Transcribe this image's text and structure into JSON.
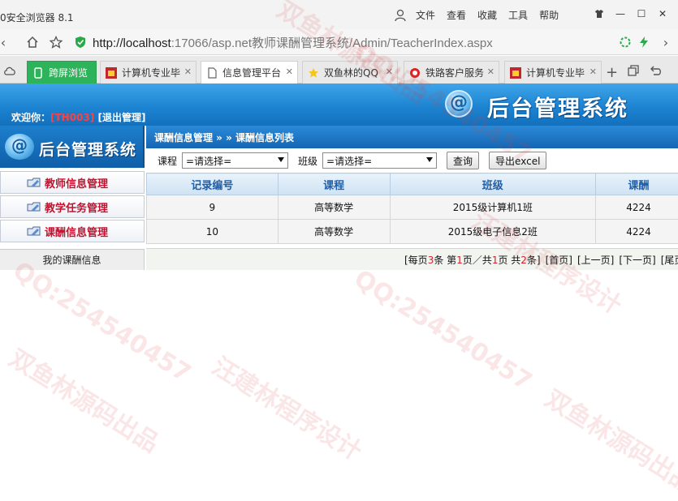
{
  "browser": {
    "app_title": "0安全浏览器 8.1",
    "menus": [
      "文件",
      "查看",
      "收藏",
      "工具",
      "帮助"
    ],
    "url_host": "http://localhost",
    "url_rest": ":17066/asp.net教师课酬管理系统/Admin/TeacherIndex.aspx",
    "tabs": [
      {
        "label": "跨屏浏览"
      },
      {
        "label": "计算机专业毕"
      },
      {
        "label": "信息管理平台"
      },
      {
        "label": "双鱼林的QQ"
      },
      {
        "label": "铁路客户服务"
      },
      {
        "label": "计算机专业毕"
      }
    ]
  },
  "header": {
    "welcome": "欢迎你：",
    "user_id": "[TH003]",
    "logout": "[退出管理]",
    "logo_glyph": "@",
    "system_name": "后台管理系统"
  },
  "sidebar": {
    "logo_glyph": "@",
    "logo_text": "后台管理系统",
    "items": [
      {
        "label": "教师信息管理"
      },
      {
        "label": "教学任务管理"
      },
      {
        "label": "课酬信息管理"
      }
    ],
    "footer": "我的课酬信息"
  },
  "breadcrumb": "课酬信息管理 » » 课酬信息列表",
  "filter": {
    "course_label": "课程",
    "course_value": "=请选择=",
    "class_label": "班级",
    "class_value": "=请选择=",
    "query_label": "查询",
    "export_label": "导出excel"
  },
  "table": {
    "headers": [
      "记录编号",
      "课程",
      "班级",
      "课酬"
    ],
    "rows": [
      [
        "9",
        "高等数学",
        "2015级计算机1班",
        "4224"
      ],
      [
        "10",
        "高等数学",
        "2015级电子信息2班",
        "4224"
      ]
    ]
  },
  "pager": {
    "per_page_prefix": "[每页",
    "per_page": "3",
    "per_page_mid": "条 第",
    "current_page": "1",
    "mid2": "页／共",
    "total_pages": "1",
    "mid3": "页 共",
    "total_records": "2",
    "suffix": "条]",
    "first": "[首页]",
    "prev": "[上一页]",
    "next": "[下一页]",
    "last": "[尾页]"
  },
  "watermark": [
    "双鱼林源码出品",
    "QQ:254540457",
    "汪建林程序设计"
  ],
  "colors": {
    "header_blue": "#1d84d2",
    "sidebar_label_red": "#c8102e",
    "table_header_text": "#1f5fa8",
    "pager_number_red": "#d2202a"
  }
}
